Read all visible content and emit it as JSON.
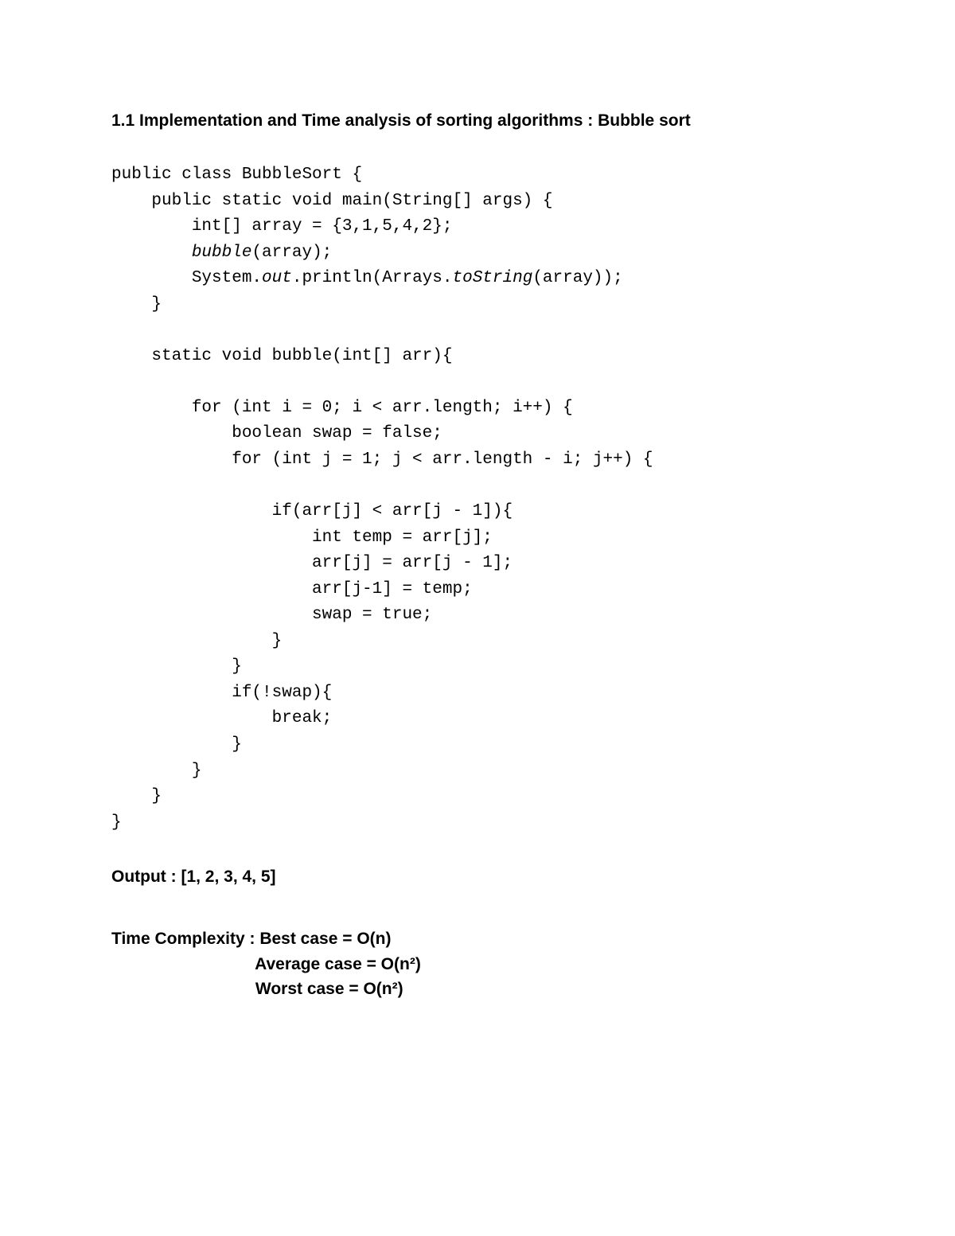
{
  "heading": "1.1 Implementation and Time analysis of sorting algorithms : Bubble sort",
  "code": {
    "l1": "public class BubbleSort {",
    "l2": "    public static void main(String[] args) {",
    "l3": "        int[] array = {3,1,5,4,2};",
    "l4a": "        ",
    "l4b": "bubble",
    "l4c": "(array);",
    "l5a": "        System.",
    "l5b": "out",
    "l5c": ".println(Arrays.",
    "l5d": "toString",
    "l5e": "(array));",
    "l6": "    }",
    "l7": "",
    "l8": "    static void bubble(int[] arr){",
    "l9": "",
    "l10": "        for (int i = 0; i < arr.length; i++) {",
    "l11": "            boolean swap = false;",
    "l12": "            for (int j = 1; j < arr.length - i; j++) {",
    "l13": "",
    "l14": "                if(arr[j] < arr[j - 1]){",
    "l15": "                    int temp = arr[j];",
    "l16": "                    arr[j] = arr[j - 1];",
    "l17": "                    arr[j-1] = temp;",
    "l18": "                    swap = true;",
    "l19": "                }",
    "l20": "            }",
    "l21": "            if(!swap){",
    "l22": "                break;",
    "l23": "            }",
    "l24": "        }",
    "l25": "    }",
    "l26": "}"
  },
  "output": {
    "label": "Output : ",
    "value": "[1, 2, 3, 4, 5]"
  },
  "complexity": {
    "label": "Time Complexity : ",
    "best": "Best case = O(n)",
    "average_indent": "                               ",
    "average": "Average case = O(n²)",
    "worst_indent": "                               ",
    "worst": "Worst case = O(n²)"
  }
}
